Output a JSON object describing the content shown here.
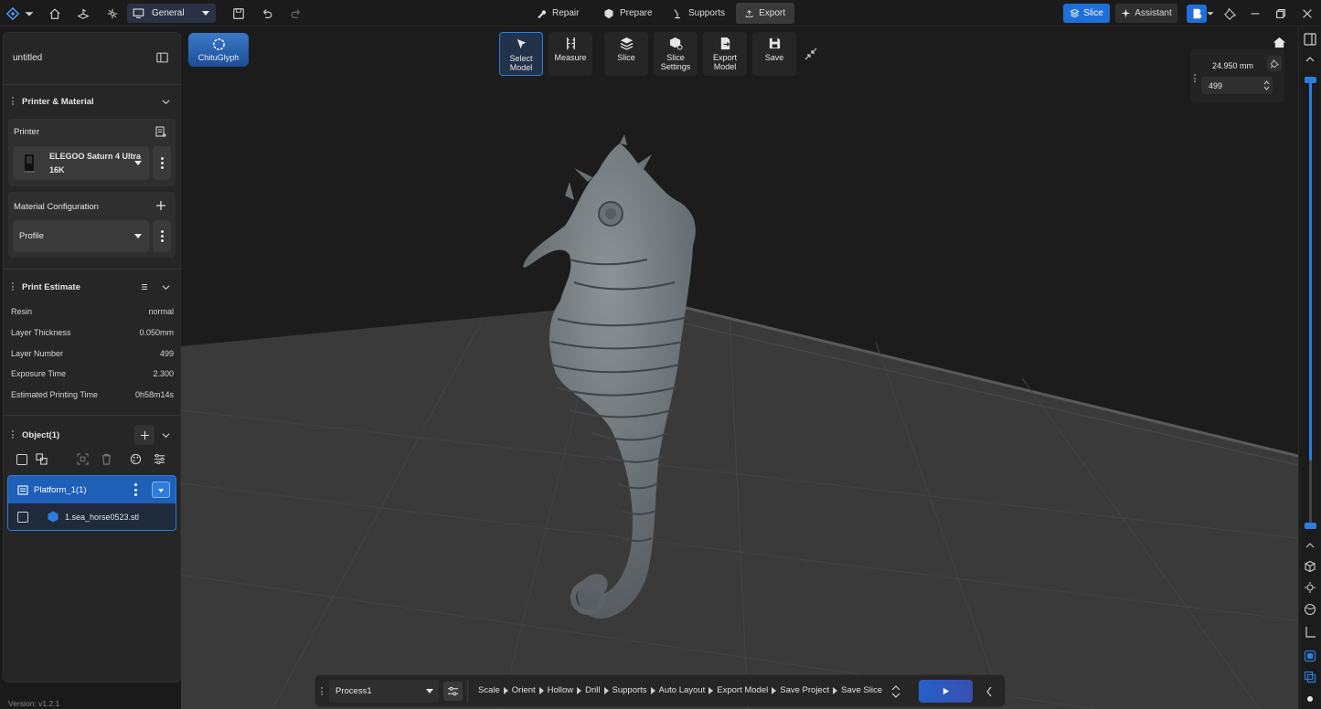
{
  "topbar": {
    "workspace": "General",
    "stages": [
      "Repair",
      "Prepare",
      "Supports",
      "Export"
    ],
    "active_stage": "Export",
    "slice_label": "Slice",
    "assistant_label": "Assistant"
  },
  "sidebar": {
    "project_name": "untitled",
    "printer_material": {
      "title": "Printer & Material",
      "printer_label": "Printer",
      "printer_name_line1": "ELEGOO Saturn 4 Ultra",
      "printer_name_line2": "16K",
      "material_label": "Material Configuration",
      "profile_value": "Profile"
    },
    "print_estimate": {
      "title": "Print Estimate",
      "rows": [
        {
          "label": "Resin",
          "value": "normal"
        },
        {
          "label": "Layer Thickness",
          "value": "0.050mm"
        },
        {
          "label": "Layer Number",
          "value": "499"
        },
        {
          "label": "Exposure Time",
          "value": "2.300"
        },
        {
          "label": "Estimated Printing Time",
          "value": "0h58m14s"
        }
      ]
    },
    "objects": {
      "title": "Object(1)",
      "platform_label": "Platform_1(1)",
      "file_label": "1.sea_horse0523.stl"
    },
    "version": "Version: v1.2.1"
  },
  "viewport": {
    "brand_label": "ChituGlyph",
    "tools": [
      {
        "line1": "Select",
        "line2": "Model"
      },
      {
        "line1": "Measure",
        "line2": ""
      },
      {
        "line1": "Slice",
        "line2": ""
      },
      {
        "line1": "Slice",
        "line2": "Settings"
      },
      {
        "line1": "Export",
        "line2": "Model"
      },
      {
        "line1": "Save",
        "line2": ""
      }
    ],
    "height_value": "24.950 mm",
    "layer_value": "499",
    "slider_level": 0.15
  },
  "bottombar": {
    "process_value": "Process1",
    "steps": [
      "Scale",
      "Orient",
      "Hollow",
      "Drill",
      "Supports",
      "Auto Layout",
      "Export Model",
      "Save Project",
      "Save Slice"
    ]
  },
  "colors": {
    "accent": "#1e6fd9",
    "panel": "#262626",
    "background": "#1c1c1c",
    "model": "#6f7679"
  }
}
